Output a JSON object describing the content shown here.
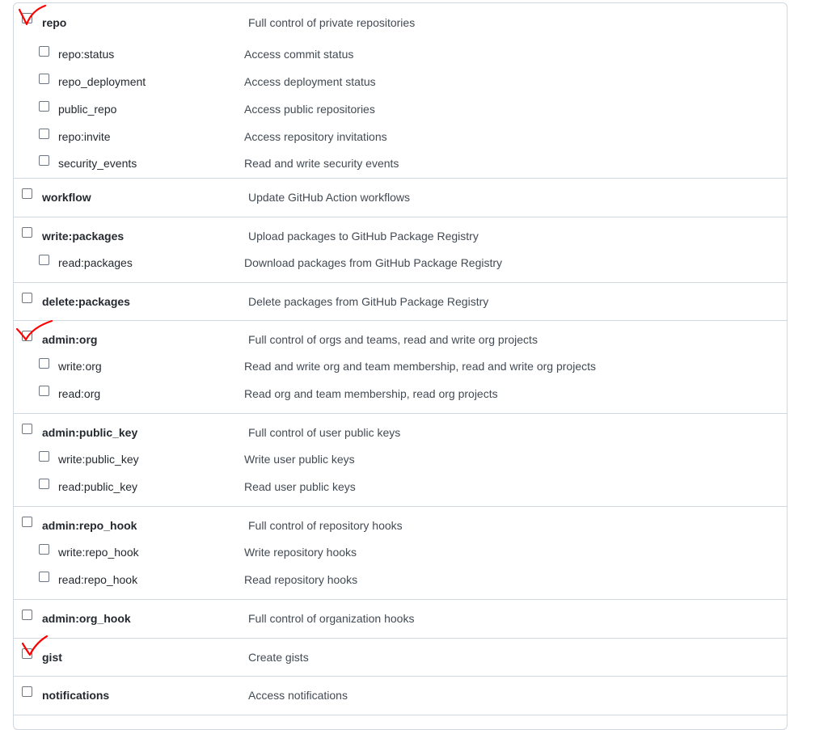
{
  "accent_color": "#ff0000",
  "groups": [
    {
      "top": {
        "name": "repo",
        "desc": "Full control of private repositories"
      },
      "subs": [
        {
          "name": "repo:status",
          "desc": "Access commit status"
        },
        {
          "name": "repo_deployment",
          "desc": "Access deployment status"
        },
        {
          "name": "public_repo",
          "desc": "Access public repositories"
        },
        {
          "name": "repo:invite",
          "desc": "Access repository invitations"
        },
        {
          "name": "security_events",
          "desc": "Read and write security events"
        }
      ]
    },
    {
      "top": {
        "name": "workflow",
        "desc": "Update GitHub Action workflows"
      },
      "subs": []
    },
    {
      "top": {
        "name": "write:packages",
        "desc": "Upload packages to GitHub Package Registry"
      },
      "subs": [
        {
          "name": "read:packages",
          "desc": "Download packages from GitHub Package Registry"
        }
      ]
    },
    {
      "top": {
        "name": "delete:packages",
        "desc": "Delete packages from GitHub Package Registry"
      },
      "subs": []
    },
    {
      "top": {
        "name": "admin:org",
        "desc": "Full control of orgs and teams, read and write org projects"
      },
      "subs": [
        {
          "name": "write:org",
          "desc": "Read and write org and team membership, read and write org projects"
        },
        {
          "name": "read:org",
          "desc": "Read org and team membership, read org projects"
        }
      ]
    },
    {
      "top": {
        "name": "admin:public_key",
        "desc": "Full control of user public keys"
      },
      "subs": [
        {
          "name": "write:public_key",
          "desc": "Write user public keys"
        },
        {
          "name": "read:public_key",
          "desc": "Read user public keys"
        }
      ]
    },
    {
      "top": {
        "name": "admin:repo_hook",
        "desc": "Full control of repository hooks"
      },
      "subs": [
        {
          "name": "write:repo_hook",
          "desc": "Write repository hooks"
        },
        {
          "name": "read:repo_hook",
          "desc": "Read repository hooks"
        }
      ]
    },
    {
      "top": {
        "name": "admin:org_hook",
        "desc": "Full control of organization hooks"
      },
      "subs": []
    },
    {
      "top": {
        "name": "gist",
        "desc": "Create gists"
      },
      "subs": []
    },
    {
      "top": {
        "name": "notifications",
        "desc": "Access notifications"
      },
      "subs": []
    }
  ]
}
